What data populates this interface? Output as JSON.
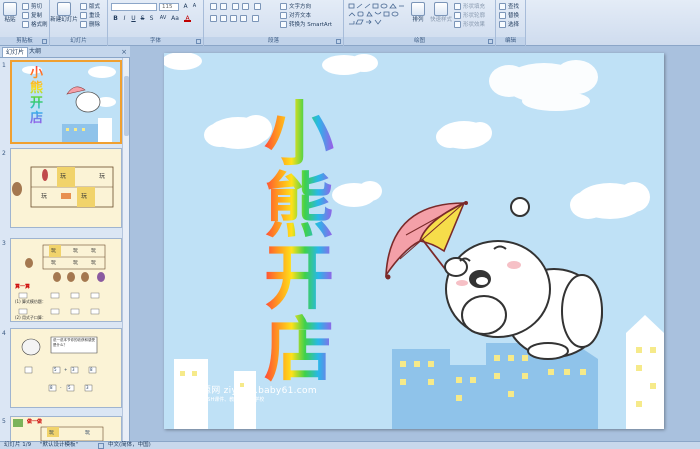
{
  "ribbon": {
    "clipboard": {
      "label": "剪贴板",
      "paste": "粘贴",
      "cut": "剪切",
      "copy": "复制",
      "format_painter": "格式刷"
    },
    "slides": {
      "label": "幻灯片",
      "new_slide": "新建幻灯片",
      "layout": "版式",
      "reset": "重设",
      "delete": "删除"
    },
    "font": {
      "label": "字体",
      "font_name": "",
      "font_size": "115",
      "bold": "B",
      "italic": "I",
      "underline": "U",
      "strike": "S",
      "shadow": "S",
      "spacing": "AV",
      "case": "Aa",
      "color": "A"
    },
    "paragraph": {
      "label": "段落",
      "text_direction": "文字方向",
      "align_text": "对齐文本",
      "smartart": "转换为 SmartArt"
    },
    "drawing": {
      "label": "绘图",
      "arrange": "排列",
      "quick_styles": "快速样式",
      "shape_fill": "形状填充",
      "shape_outline": "形状轮廓",
      "shape_effects": "形状效果"
    },
    "editing": {
      "label": "编辑",
      "find": "查找",
      "replace": "替换",
      "select": "选择"
    }
  },
  "panel": {
    "tab_slides": "幻灯片",
    "tab_outline": "大纲",
    "close": "×",
    "slides": [
      {
        "num": "1",
        "title": "小熊开店"
      },
      {
        "num": "2",
        "items": [
          "玩",
          "玩",
          "玩",
          "玩"
        ]
      },
      {
        "num": "3",
        "items": [
          "玩",
          "玩",
          "玩",
          "玩",
          "玩",
          "玩"
        ],
        "heading": "算一算",
        "line1": "(1) 算式模仿题：",
        "line2": "(2) 用式子口算："
      },
      {
        "num": "4",
        "bubble": "说一说本节你的收获和感受是什么？",
        "eq1": [
          "5",
          "+",
          "3",
          "8"
        ],
        "eq2": [
          "8",
          "-",
          "5",
          "3"
        ]
      },
      {
        "num": "5",
        "heading": "做一做",
        "items": [
          "玩",
          "玩"
        ]
      }
    ]
  },
  "slide": {
    "title_chars": [
      "小",
      "熊",
      "开",
      "店"
    ],
    "watermark_line1": "幼教资源网 ziyuan.baby61.com",
    "watermark_line2": "PPT课件、FLASH课件、教学图片、学校"
  },
  "status": {
    "slide_position": "幻灯片 1/9",
    "theme": "\"默认设计模板\"",
    "language": "中文(简体，中国)"
  },
  "colors": {
    "ribbon_bg": "#dbe6f4",
    "sky": "#bfe1f6",
    "selected_border": "#f0a030",
    "building": "#8fc3ea"
  }
}
